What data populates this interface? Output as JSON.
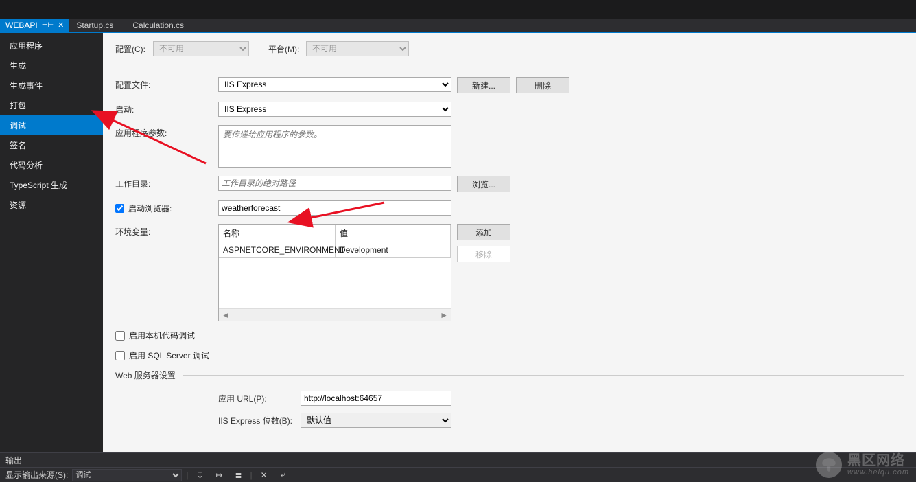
{
  "tabs": {
    "project": "WEBAPI",
    "file1": "Startup.cs",
    "file2": "Calculation.cs"
  },
  "sidebar": {
    "items": [
      "应用程序",
      "生成",
      "生成事件",
      "打包",
      "调试",
      "签名",
      "代码分析",
      "TypeScript 生成",
      "资源"
    ]
  },
  "form": {
    "config_label": "配置(C):",
    "config_value": "不可用",
    "platform_label": "平台(M):",
    "platform_value": "不可用",
    "profile_label": "配置文件:",
    "profile_value": "IIS Express",
    "btn_new": "新建...",
    "btn_delete": "删除",
    "launch_label": "启动:",
    "launch_value": "IIS Express",
    "appargs_label": "应用程序参数:",
    "appargs_placeholder": "要传递给应用程序的参数。",
    "workdir_label": "工作目录:",
    "workdir_placeholder": "工作目录的绝对路径",
    "btn_browse": "浏览...",
    "launchbrowser_label": "启动浏览器:",
    "launchbrowser_value": "weatherforecast",
    "env_label": "环境变量:",
    "env_head_name": "名称",
    "env_head_value": "值",
    "env_row_name": "ASPNETCORE_ENVIRONMENT",
    "env_row_value": "Development",
    "btn_add": "添加",
    "btn_remove": "移除",
    "chk_native": "启用本机代码调试",
    "chk_sql": "启用 SQL Server 调试",
    "section_web": "Web 服务器设置",
    "appurl_label": "应用 URL(P):",
    "appurl_value": "http://localhost:64657",
    "iisbits_label": "IIS Express 位数(B):",
    "iisbits_value": "默认值"
  },
  "bottom": {
    "output": "输出",
    "source_label": "显示输出来源(S):",
    "source_value": "调试"
  },
  "watermark": {
    "title": "黑区网络",
    "sub": "www.heiqu.com"
  }
}
